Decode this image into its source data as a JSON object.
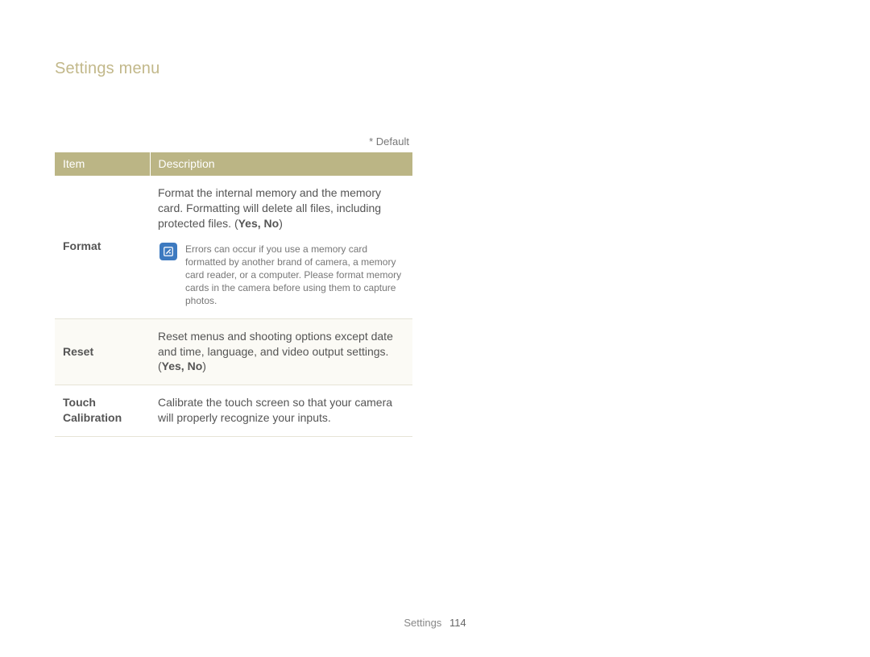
{
  "page": {
    "title": "Settings menu",
    "default_note": "* Default",
    "footer_section": "Settings",
    "footer_page": "114"
  },
  "table": {
    "headers": {
      "item": "Item",
      "desc": "Description"
    },
    "rows": [
      {
        "item": "Format",
        "desc_line1": "Format the internal memory and the memory card. Formatting will delete all files, including protected files. (",
        "yesno": "Yes, No",
        "desc_close": ")",
        "note": "Errors can occur if you use a memory card formatted by another brand of camera, a memory card reader, or a computer. Please format memory cards in the camera before using them to capture photos."
      },
      {
        "item": "Reset",
        "desc_line1": "Reset menus and shooting options except date and time, language, and video output settings. (",
        "yesno": "Yes, No",
        "desc_close": ")"
      },
      {
        "item": "Touch Calibration",
        "desc_line1": "Calibrate the touch screen so that your camera will properly recognize your inputs."
      }
    ]
  }
}
